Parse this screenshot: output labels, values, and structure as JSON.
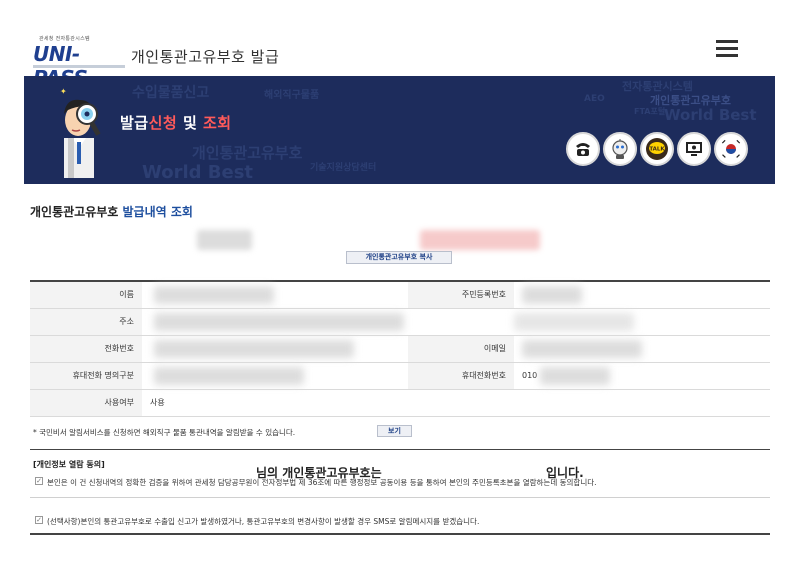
{
  "header": {
    "logo_small": "관세청 전자통관시스템",
    "logo_main": "UNI-PASS",
    "title": "개인통관고유부호 발급",
    "menu_icon": "hamburger-menu-icon"
  },
  "banner": {
    "title_part1": "발급",
    "title_part2": "신청",
    "title_part3": " 및 ",
    "title_part4": "조회",
    "cloud_words": [
      "수입물품신고",
      "해외직구물품",
      "개인통관고유부호",
      "World Best",
      "기술지원상담센터",
      "전자통관시스템",
      "개인통관고유부호",
      "World Best",
      "FTA포털",
      "AEO"
    ],
    "icons": [
      "phone-support-icon",
      "robot-chat-icon",
      "kakao-talk-icon",
      "remote-support-icon",
      "government-seal-icon"
    ],
    "icon_talk_label": "TALK"
  },
  "page": {
    "section_title_plain": "개인통관고유부호 ",
    "section_title_blue": "발급내역 조회",
    "result_text1": "님의 개인통관고유부호는",
    "result_text2": "입니다.",
    "copy_button": "개인통관고유부호 복사"
  },
  "info": {
    "name_label": "이름",
    "rrn_label": "주민등록번호",
    "address_label": "주소",
    "phone_label": "전화번호",
    "email_label": "이메일",
    "mobile_owner_label": "휴대전화 명의구분",
    "mobile_label": "휴대전화번호",
    "mobile_value": "010",
    "use_label": "사용여부",
    "use_value": "사용"
  },
  "notice": {
    "text": "* 국민비서 알림서비스를 신청하면 해외직구 물품 통관내역을 알림받을 수 있습니다.",
    "button": "보기"
  },
  "consent": {
    "heading": "[개인정보 열람 동의]",
    "item1": "본인은 이 건 신청내역의 정확한 검증을 위하여 관세청 담당공무원이 전자정부법 제 36조에 따른 행정정보 공동이용 등을 통하여 본인의 주민등록초본을 열람하는데 동의합니다.",
    "item2": "(선택사항)본인의 통관고유부호로 수출입 신고가 발생하였거나, 통관고유부호의 변경사항이 발생할 경우 SMS로 알림메시지를 받겠습니다."
  }
}
